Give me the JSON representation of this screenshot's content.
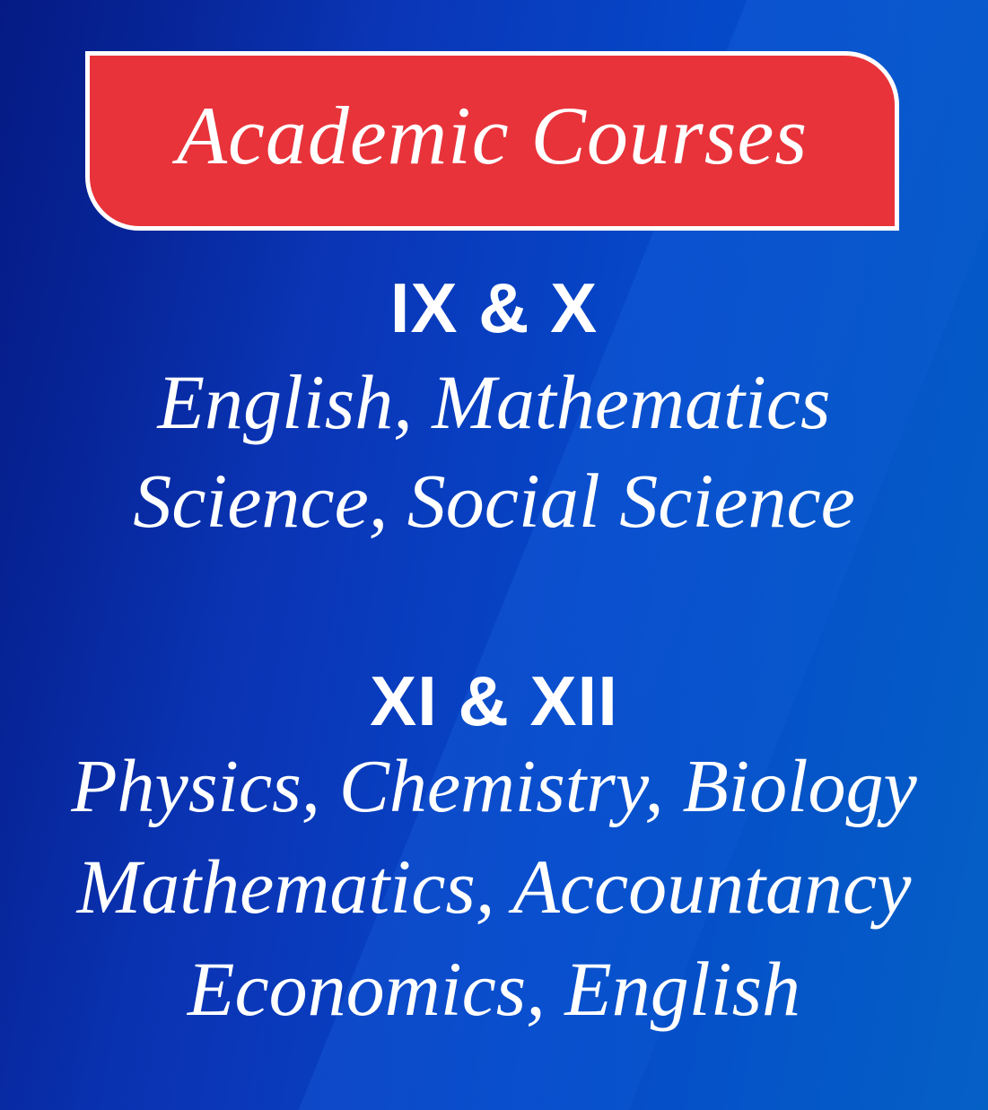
{
  "banner": {
    "title": "Academic Courses"
  },
  "sections": [
    {
      "heading": "IX & X",
      "lines": [
        "English, Mathematics",
        "Science, Social Science"
      ]
    },
    {
      "heading": "XI & XII",
      "lines": [
        "Physics, Chemistry, Biology",
        "Mathematics, Accountancy",
        "Economics, English"
      ]
    }
  ],
  "colors": {
    "banner": "#e8333a",
    "background_dark": "#07239a",
    "background_light": "#0560c6",
    "text": "#ffffff"
  }
}
